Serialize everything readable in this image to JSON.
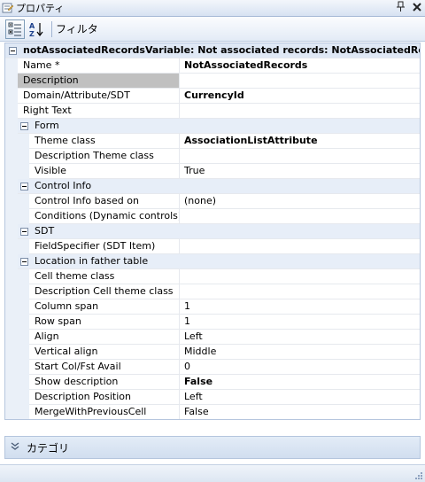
{
  "window": {
    "title": "プロパティ",
    "pin_glyph": "ꟸ",
    "close_glyph": "✕"
  },
  "toolbar": {
    "filter_label": "フィルタ",
    "sort_glyph": "A↓Z"
  },
  "object": {
    "header": "notAssociatedRecordsVariable: Not associated records: NotAssociatedRecords"
  },
  "properties": [
    {
      "name": "Name *",
      "value": "NotAssociatedRecords",
      "bold": true
    },
    {
      "name": "Description",
      "value": "",
      "selected": true
    },
    {
      "name": "Domain/Attribute/SDT",
      "value": "CurrencyId",
      "bold": true
    },
    {
      "name": "Right Text",
      "value": ""
    }
  ],
  "categories": [
    {
      "label": "Form",
      "items": [
        {
          "name": "Theme class",
          "value": "AssociationListAttribute",
          "bold": true
        },
        {
          "name": "Description Theme class",
          "value": ""
        },
        {
          "name": "Visible",
          "value": "True"
        }
      ]
    },
    {
      "label": "Control Info",
      "items": [
        {
          "name": "Control Info based on",
          "value": "(none)"
        },
        {
          "name": "Conditions (Dynamic controls)",
          "value": ""
        }
      ]
    },
    {
      "label": "SDT",
      "items": [
        {
          "name": "FieldSpecifier (SDT Item)",
          "value": ""
        }
      ]
    },
    {
      "label": "Location in father table",
      "items": [
        {
          "name": "Cell theme class",
          "value": ""
        },
        {
          "name": "Description Cell theme class",
          "value": ""
        },
        {
          "name": "Column span",
          "value": "1"
        },
        {
          "name": "Row span",
          "value": "1"
        },
        {
          "name": "Align",
          "value": "Left"
        },
        {
          "name": "Vertical align",
          "value": "Middle"
        },
        {
          "name": "Start Col/Fst Avail",
          "value": "0"
        },
        {
          "name": "Show description",
          "value": "False",
          "bold": true
        },
        {
          "name": "Description Position",
          "value": "Left"
        },
        {
          "name": "MergeWithPreviousCell",
          "value": "False"
        }
      ]
    }
  ],
  "category_panel": {
    "label": "カテゴリ",
    "chevron": "︾"
  }
}
